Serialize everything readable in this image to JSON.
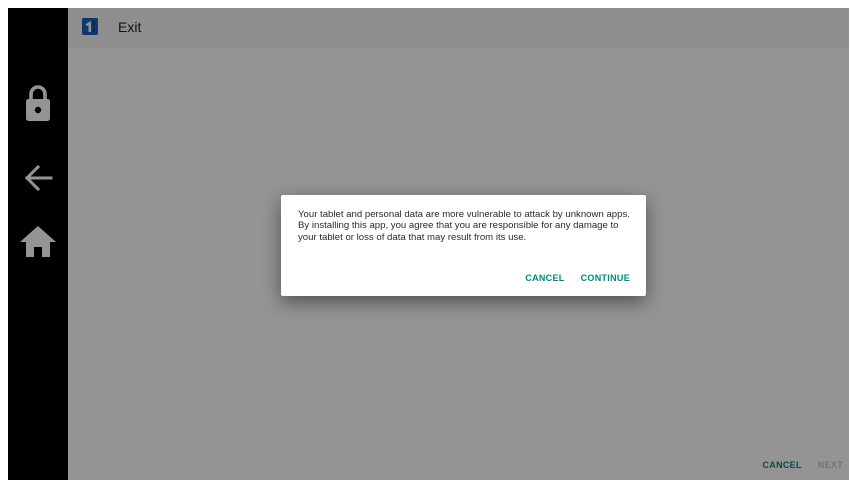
{
  "navbar": {
    "items": [
      {
        "icon": "lock-icon"
      },
      {
        "icon": "back-arrow-icon"
      },
      {
        "icon": "home-icon"
      }
    ]
  },
  "app_bar": {
    "icon": "app-logo-icon",
    "title": "Exit"
  },
  "footer": {
    "cancel_label": "CANCEL",
    "next_label": "NEXT"
  },
  "dialog": {
    "message": "Your tablet and personal data are more vulnerable to attack by unknown apps. By installing this app, you agree that you are responsible for any damage to your tablet or loss of data that may result from its use.",
    "cancel_label": "CANCEL",
    "continue_label": "CONTINUE"
  },
  "colors": {
    "accent": "#00897b",
    "navbar_bg": "#000000",
    "scrim": "rgba(0,0,0,0.42)",
    "disabled_text": "#c8c8c8"
  }
}
